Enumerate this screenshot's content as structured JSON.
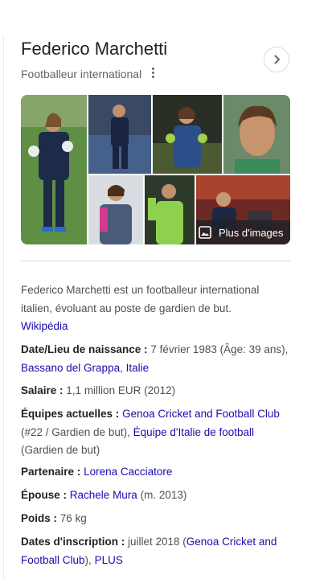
{
  "panel": {
    "title": "Federico Marchetti",
    "subtitle": "Footballeur international",
    "more_images_label": "Plus d'images"
  },
  "icons": {
    "more_options": "vertical-dots-icon",
    "next": "chevron-right-icon",
    "images": "image-icon"
  },
  "description": {
    "text": "Federico Marchetti est un footballeur international italien, évoluant au poste de gardien de but.",
    "source_link": "Wikipédia"
  },
  "facts": {
    "birth": {
      "label": "Date/Lieu de naissance :",
      "value": "7 février 1983 (Âge: 39 ans),",
      "link1": "Bassano del Grappa",
      "sep": ",",
      "link2": "Italie"
    },
    "salary": {
      "label": "Salaire :",
      "value": "1,1 million EUR (2012)"
    },
    "teams": {
      "label": "Équipes actuelles :",
      "link1": "Genoa Cricket and Football Club",
      "text1": "(#22 / Gardien de but),",
      "link2": "Équipe d'Italie de football",
      "text2": "(Gardien de but)"
    },
    "partner": {
      "label": "Partenaire :",
      "link": "Lorena Cacciatore"
    },
    "spouse": {
      "label": "Épouse :",
      "link": "Rachele Mura",
      "value": "(m. 2013)"
    },
    "weight": {
      "label": "Poids :",
      "value": "76 kg"
    },
    "signing": {
      "label": "Dates d'inscription :",
      "value": "juillet 2018 (",
      "link1": "Genoa Cricket and Football Club",
      "sep": "),",
      "link2": "PLUS"
    }
  },
  "colors": {
    "link": "#1a0dab",
    "text": "#4d5156",
    "heading": "#202124",
    "muted": "#5f6368"
  }
}
